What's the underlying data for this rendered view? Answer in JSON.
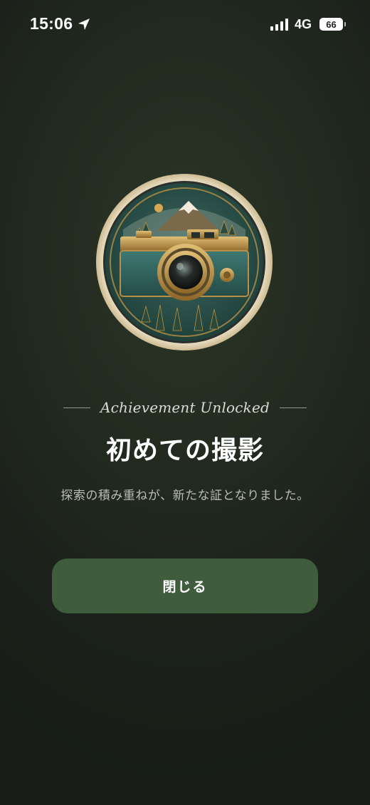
{
  "status_bar": {
    "time": "15:06",
    "network": "4G",
    "battery": "66",
    "icons": [
      "location-arrow-icon",
      "signal-icon",
      "battery-icon"
    ]
  },
  "badge": {
    "icon": "vintage-camera-mountain-badge",
    "colors": {
      "ring": "#efe3c6",
      "body": "#2f5a52",
      "brass": "#b88f45"
    }
  },
  "achievement": {
    "label": "Achievement Unlocked",
    "title": "初めての撮影",
    "description": "探索の積み重ねが、新たな証となりました。"
  },
  "actions": {
    "close_label": "閉じる"
  },
  "colors": {
    "background": "#1e251c",
    "button": "#3f5c3c",
    "text_secondary": "#b9bdb3"
  }
}
